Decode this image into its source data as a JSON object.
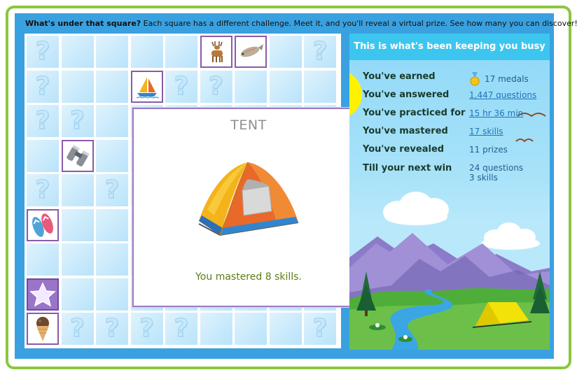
{
  "header": {
    "bold": "What's under that square?",
    "text": " Each square has a different challenge. Meet it, and you'll reveal a virtual prize. See how many you can discover!"
  },
  "grid": {
    "question_mark": "?",
    "cells": [
      [
        "q",
        "empty",
        "empty",
        "empty",
        "empty",
        "deer",
        "fish",
        "empty",
        "q"
      ],
      [
        "q",
        "empty",
        "empty",
        "sailboat",
        "q",
        "q",
        "empty",
        "empty",
        "empty"
      ],
      [
        "q",
        "q",
        "empty",
        "empty",
        "empty",
        "empty",
        "empty",
        "empty",
        "empty"
      ],
      [
        "empty",
        "binoculars",
        "empty",
        "empty",
        "empty",
        "empty",
        "empty",
        "empty",
        "empty"
      ],
      [
        "q",
        "empty",
        "q",
        "empty",
        "empty",
        "empty",
        "empty",
        "empty",
        "empty"
      ],
      [
        "flip-flops",
        "empty",
        "empty",
        "empty",
        "empty",
        "empty",
        "empty",
        "empty",
        "empty"
      ],
      [
        "empty",
        "empty",
        "empty",
        "empty",
        "empty",
        "empty",
        "empty",
        "empty",
        "empty"
      ],
      [
        "star",
        "empty",
        "empty",
        "empty",
        "empty",
        "empty",
        "empty",
        "empty",
        "empty"
      ],
      [
        "ice-cream",
        "q",
        "q",
        "q",
        "q",
        "empty",
        "empty",
        "empty",
        "q"
      ]
    ]
  },
  "popup": {
    "title": "TENT",
    "message": "You mastered 8 skills.",
    "image_icon": "tent-icon"
  },
  "panel": {
    "title": "This is what's been keeping you busy",
    "stats": [
      {
        "label": "You've earned",
        "value": "17 medals",
        "icon": "medal-icon",
        "link": false
      },
      {
        "label": "You've answered",
        "value": "1,447 questions",
        "link": true
      },
      {
        "label": "You've practiced for",
        "value": "15 hr 36 min",
        "link": true
      },
      {
        "label": "You've mastered",
        "value": "17 skills",
        "link": true
      },
      {
        "label": "You've revealed",
        "value": "11 prizes",
        "link": false
      },
      {
        "label": "Till your next win",
        "value": "24 questions",
        "value2": "3 skills",
        "link": false
      }
    ]
  },
  "colors": {
    "frame": "#8cc63f",
    "background": "#3aa1e0",
    "popup_border": "#9b7dc4",
    "panel_header": "#3cc6ef",
    "message": "#5a7d14"
  }
}
